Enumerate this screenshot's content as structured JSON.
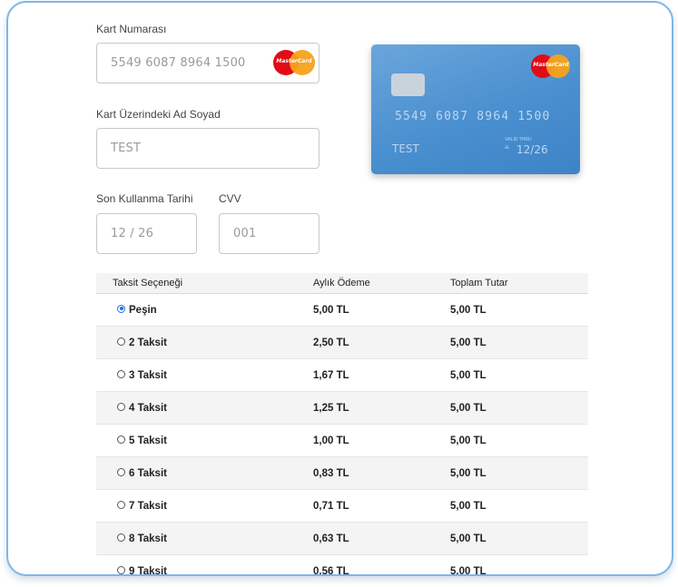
{
  "form": {
    "card_number_label": "Kart Numarası",
    "card_number_value": "5549 6087 8964 1500",
    "name_label": "Kart Üzerindeki Ad Soyad",
    "name_value": "TEST",
    "expiry_label": "Son Kullanma Tarihi",
    "expiry_value": "12 / 26",
    "cvv_label": "CVV",
    "cvv_value": "001",
    "brand_logo_text": "MasterCard"
  },
  "card_preview": {
    "number": "5549 6087 8964 1500",
    "name": "TEST",
    "valid_thru_label": "VALID THRU",
    "expiry": "12/26",
    "brand_logo_text": "MasterCard",
    "color": "#4a8fcf"
  },
  "installments": {
    "headers": [
      "Taksit Seçeneği",
      "Aylık Ödeme",
      "Toplam Tutar"
    ],
    "selected_index": 0,
    "rows": [
      {
        "option": "Peşin",
        "monthly": "5,00 TL",
        "total": "5,00 TL"
      },
      {
        "option": "2 Taksit",
        "monthly": "2,50 TL",
        "total": "5,00 TL"
      },
      {
        "option": "3 Taksit",
        "monthly": "1,67 TL",
        "total": "5,00 TL"
      },
      {
        "option": "4 Taksit",
        "monthly": "1,25 TL",
        "total": "5,00 TL"
      },
      {
        "option": "5 Taksit",
        "monthly": "1,00 TL",
        "total": "5,00 TL"
      },
      {
        "option": "6 Taksit",
        "monthly": "0,83 TL",
        "total": "5,00 TL"
      },
      {
        "option": "7 Taksit",
        "monthly": "0,71 TL",
        "total": "5,00 TL"
      },
      {
        "option": "8 Taksit",
        "monthly": "0,63 TL",
        "total": "5,00 TL"
      },
      {
        "option": "9 Taksit",
        "monthly": "0,56 TL",
        "total": "5,00 TL"
      }
    ]
  },
  "colors": {
    "frame_border": "#7fb6e6",
    "radio_selected": "#1a73e8",
    "mastercard_red": "#e30b17",
    "mastercard_orange": "#f7a21b"
  }
}
